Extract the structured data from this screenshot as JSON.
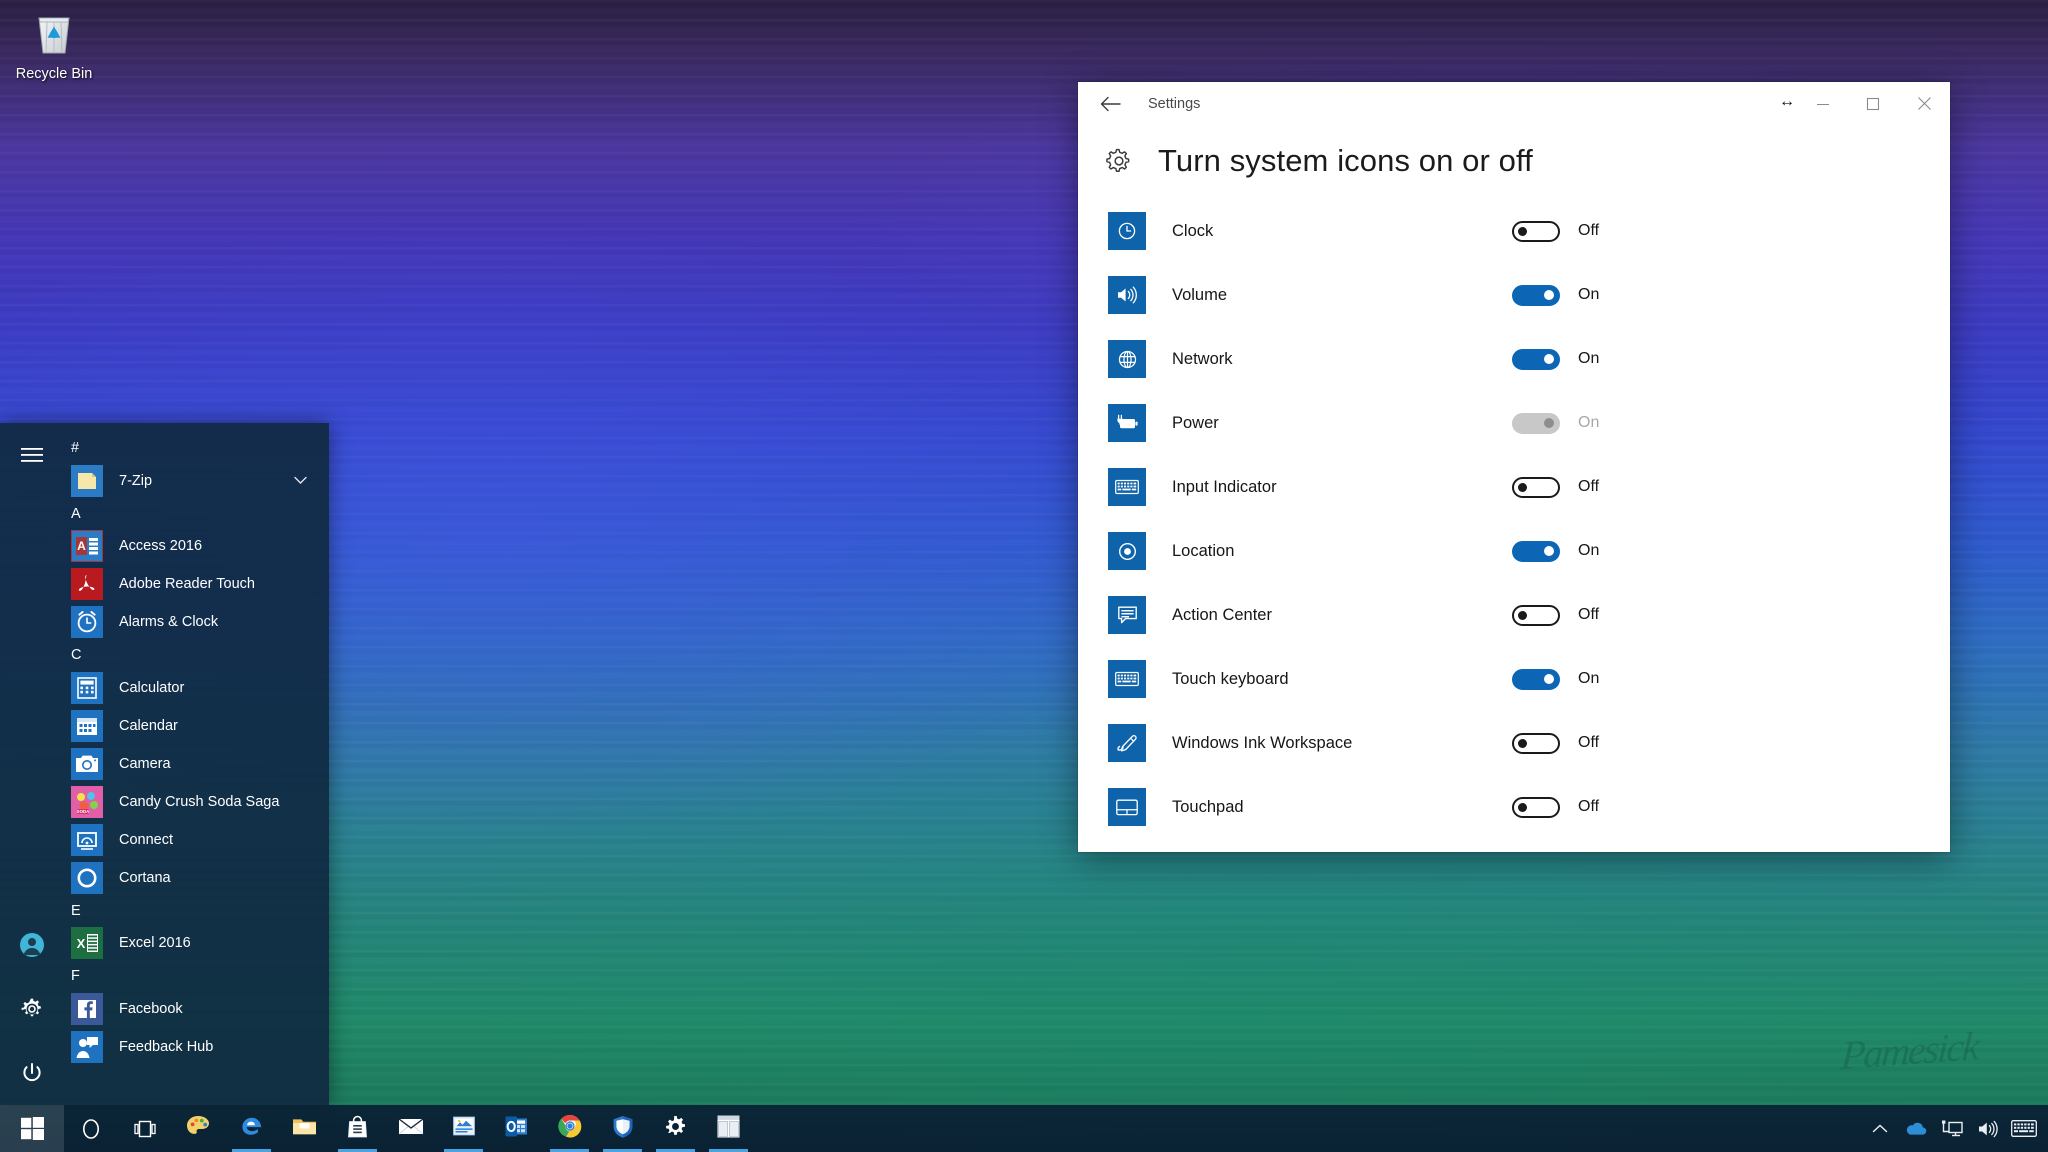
{
  "desktop": {
    "recycle_bin_label": "Recycle Bin",
    "wallpaper_signature": "Pamesick"
  },
  "start_menu": {
    "hamburger_icon": "hamburger-icon",
    "rail_items": [
      {
        "name": "user-account",
        "icon": "user-avatar-icon"
      },
      {
        "name": "settings",
        "icon": "gear-icon"
      },
      {
        "name": "power",
        "icon": "power-icon"
      }
    ],
    "groups": [
      {
        "letter": "#",
        "apps": [
          {
            "label": "7-Zip",
            "icon": "folder-icon",
            "tile_color": "#2b7cc4",
            "glyph": "■",
            "has_chevron": true
          }
        ]
      },
      {
        "letter": "A",
        "apps": [
          {
            "label": "Access 2016",
            "icon": "access-icon",
            "tile_color": "#a4373a",
            "glyph": "A"
          },
          {
            "label": "Adobe Reader Touch",
            "icon": "adobe-reader-icon",
            "tile_color": "#b81a20",
            "glyph": "A"
          },
          {
            "label": "Alarms & Clock",
            "icon": "alarm-clock-icon",
            "tile_color": "#1f72c0",
            "glyph": "⏰"
          }
        ]
      },
      {
        "letter": "C",
        "apps": [
          {
            "label": "Calculator",
            "icon": "calculator-icon",
            "tile_color": "#1f72c0",
            "glyph": "⌸"
          },
          {
            "label": "Calendar",
            "icon": "calendar-icon",
            "tile_color": "#1f72c0",
            "glyph": "Ὄ5"
          },
          {
            "label": "Camera",
            "icon": "camera-icon",
            "tile_color": "#1f72c0",
            "glyph": "◉"
          },
          {
            "label": "Candy Crush Soda Saga",
            "icon": "candy-crush-icon",
            "tile_color": "#e05fa8",
            "glyph": "❦"
          },
          {
            "label": "Connect",
            "icon": "connect-icon",
            "tile_color": "#1f72c0",
            "glyph": "▭"
          },
          {
            "label": "Cortana",
            "icon": "cortana-icon",
            "tile_color": "#1f72c0",
            "glyph": "◯"
          }
        ]
      },
      {
        "letter": "E",
        "apps": [
          {
            "label": "Excel 2016",
            "icon": "excel-icon",
            "tile_color": "#1d6f42",
            "glyph": "X"
          }
        ]
      },
      {
        "letter": "F",
        "apps": [
          {
            "label": "Facebook",
            "icon": "facebook-icon",
            "tile_color": "#3b5998",
            "glyph": "f"
          },
          {
            "label": "Feedback Hub",
            "icon": "feedback-hub-icon",
            "tile_color": "#1f72c0",
            "glyph": "✉"
          }
        ]
      }
    ]
  },
  "settings_window": {
    "title": "Settings",
    "back_icon": "back-arrow-icon",
    "resize_cursor_icon": "horizontal-resize-cursor",
    "controls": [
      {
        "name": "minimize-button",
        "glyph": "—"
      },
      {
        "name": "maximize-button",
        "glyph": "☐"
      },
      {
        "name": "close-button",
        "glyph": "✕"
      }
    ],
    "page": {
      "gear_icon": "gear-icon",
      "title": "Turn system icons on or off",
      "rows": [
        {
          "label": "Clock",
          "icon": "clock-icon",
          "state": "Off",
          "on": false,
          "disabled": false
        },
        {
          "label": "Volume",
          "icon": "volume-icon",
          "state": "On",
          "on": true,
          "disabled": false
        },
        {
          "label": "Network",
          "icon": "network-globe-icon",
          "state": "On",
          "on": true,
          "disabled": false
        },
        {
          "label": "Power",
          "icon": "battery-plug-icon",
          "state": "On",
          "on": true,
          "disabled": true
        },
        {
          "label": "Input Indicator",
          "icon": "keyboard-icon",
          "state": "Off",
          "on": false,
          "disabled": false
        },
        {
          "label": "Location",
          "icon": "location-target-icon",
          "state": "On",
          "on": true,
          "disabled": false
        },
        {
          "label": "Action Center",
          "icon": "action-center-icon",
          "state": "Off",
          "on": false,
          "disabled": false
        },
        {
          "label": "Touch keyboard",
          "icon": "touch-keyboard-icon",
          "state": "On",
          "on": true,
          "disabled": false
        },
        {
          "label": "Windows Ink Workspace",
          "icon": "pen-ink-icon",
          "state": "Off",
          "on": false,
          "disabled": false
        },
        {
          "label": "Touchpad",
          "icon": "touchpad-icon",
          "state": "Off",
          "on": false,
          "disabled": false
        }
      ]
    }
  },
  "taskbar": {
    "start_icon": "windows-logo-icon",
    "search_icon": "cortana-circle-icon",
    "taskview_icon": "task-view-icon",
    "apps": [
      {
        "name": "paint-3d",
        "icon": "paint-palette-icon",
        "glyph": "🎨",
        "running": false
      },
      {
        "name": "microsoft-edge",
        "icon": "edge-icon",
        "glyph": "e",
        "running": true
      },
      {
        "name": "file-explorer",
        "icon": "folder-icon",
        "glyph": "📁",
        "running": false
      },
      {
        "name": "microsoft-store",
        "icon": "store-bag-icon",
        "glyph": "🛍",
        "running": true
      },
      {
        "name": "mail",
        "icon": "mail-envelope-icon",
        "glyph": "✉",
        "running": false
      },
      {
        "name": "powerpoint",
        "icon": "powerpoint-icon",
        "glyph": "P",
        "running": true
      },
      {
        "name": "outlook",
        "icon": "outlook-icon",
        "glyph": "O",
        "running": false
      },
      {
        "name": "google-chrome",
        "icon": "chrome-icon",
        "glyph": "◉",
        "running": true
      },
      {
        "name": "windows-defender",
        "icon": "shield-icon",
        "glyph": "⛨",
        "running": true
      },
      {
        "name": "settings",
        "icon": "gear-icon",
        "glyph": "⚙",
        "running": true
      },
      {
        "name": "settings-window",
        "icon": "window-tiles-icon",
        "glyph": "▣",
        "running": true
      }
    ],
    "tray": [
      {
        "name": "show-hidden-icons",
        "icon": "chevron-up-icon"
      },
      {
        "name": "onedrive",
        "icon": "cloud-icon"
      },
      {
        "name": "network",
        "icon": "monitor-network-icon"
      },
      {
        "name": "volume",
        "icon": "speaker-icon"
      },
      {
        "name": "touch-keyboard",
        "icon": "keyboard-icon"
      }
    ]
  }
}
